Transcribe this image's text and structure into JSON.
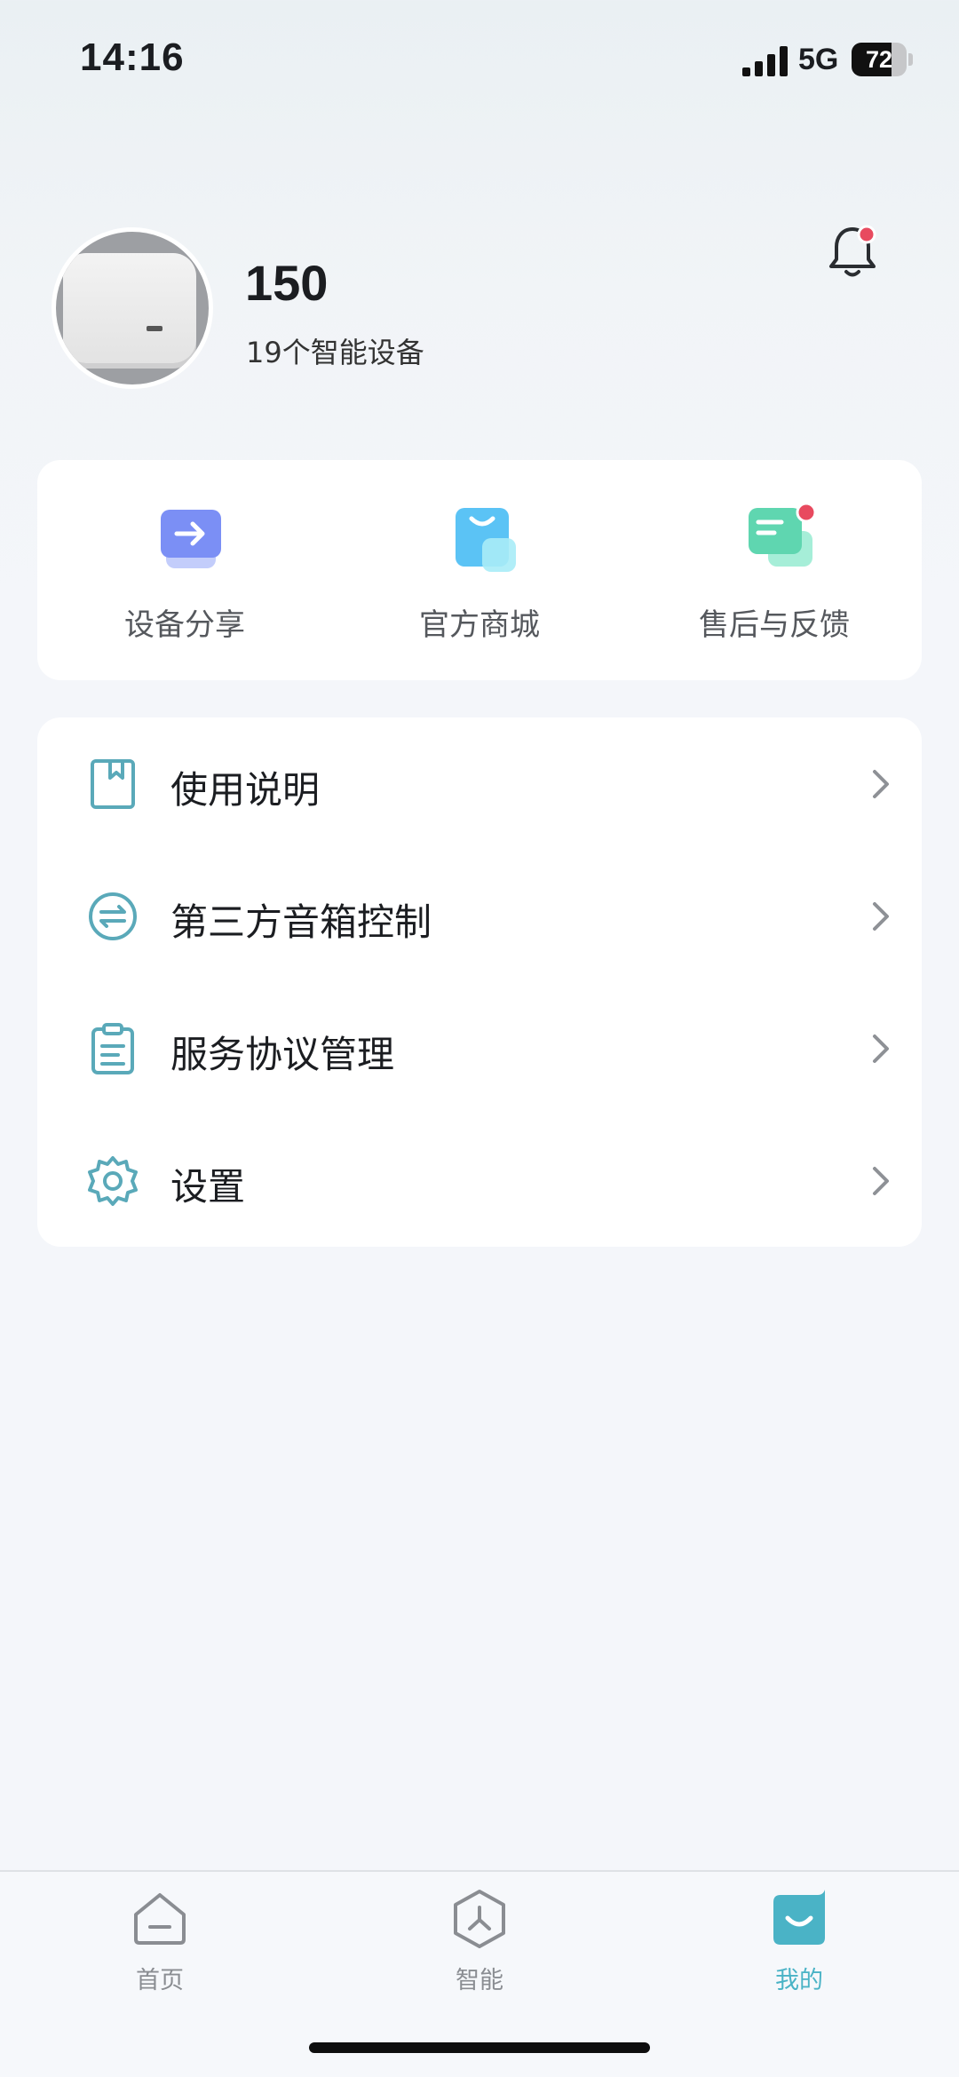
{
  "status_bar": {
    "time": "14:16",
    "network": "5G",
    "battery_level": "72",
    "battery_fraction": 0.72
  },
  "profile": {
    "name": "150",
    "device_count": "19个智能设备",
    "has_notification_dot": true
  },
  "quick_actions": [
    {
      "label": "设备分享",
      "icon": "share-arrow-icon",
      "color": "#7b8ff5"
    },
    {
      "label": "官方商城",
      "icon": "shopping-bag-icon",
      "color": "#5bc3f5"
    },
    {
      "label": "售后与反馈",
      "icon": "feedback-chat-icon",
      "color": "#5fd6b0",
      "badge": true
    }
  ],
  "menu": [
    {
      "label": "使用说明",
      "icon": "bookmark-book-icon"
    },
    {
      "label": "第三方音箱控制",
      "icon": "swap-arrows-icon"
    },
    {
      "label": "服务协议管理",
      "icon": "clipboard-icon"
    },
    {
      "label": "设置",
      "icon": "gear-icon"
    }
  ],
  "tabs": [
    {
      "label": "首页",
      "icon": "home-icon",
      "active": false
    },
    {
      "label": "智能",
      "icon": "hexagon-smart-icon",
      "active": false
    },
    {
      "label": "我的",
      "icon": "smile-profile-icon",
      "active": true
    }
  ],
  "colors": {
    "accent": "#4ab3c6",
    "badge": "#e84a5f",
    "icon_stroke": "#5aa9b9"
  }
}
